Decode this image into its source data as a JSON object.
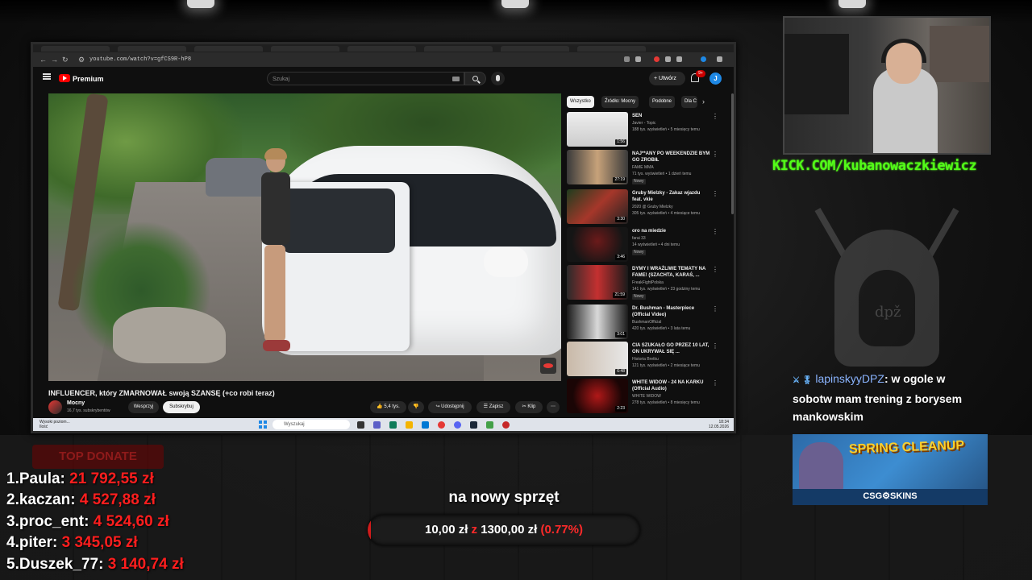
{
  "browser": {
    "url": "youtube.com/watch?v=gfCS9R-hP8",
    "brand": "Premium",
    "search_placeholder": "Szukaj",
    "create_label": "Utwórz",
    "notif_count": "9+",
    "avatar_letter": "J"
  },
  "video": {
    "title": "INFLUENCER, który ZMARNOWAŁ swoją SZANSĘ (+co robi teraz)",
    "channel": "Mocny",
    "subs": "16,7 tys. subskrybentów",
    "support_label": "Wesprzyj",
    "subscribe_label": "Subskrybuj",
    "likes": "5,4 tys.",
    "share_label": "Udostępnij",
    "save_label": "Zapisz",
    "clip_label": "Klip"
  },
  "chips": [
    "Wszystko",
    "Źródło: Mocny",
    "Podobne",
    "Dla C"
  ],
  "recommendations": [
    {
      "title": "SEN",
      "channel": "Javier - Topic",
      "meta": "188 tys. wyświetleń • 5 miesięcy temu",
      "duration": "1:56",
      "new": ""
    },
    {
      "title": "NAJ**ANY PO WEEKENDZIE BYM GO ZROBIŁ",
      "channel": "FAME MMA",
      "meta": "71 tys. wyświetleń • 1 dzień temu",
      "duration": "27:19",
      "new": "Nowy"
    },
    {
      "title": "Gruby Mielzky - Zakaz wjazdu feat. vkie",
      "channel": "2020 @ Gruby Mielzky",
      "meta": "305 tys. wyświetleń • 4 miesiące temu",
      "duration": "3:30",
      "new": ""
    },
    {
      "title": "oro na miedzie",
      "channel": "farai 33",
      "meta": "14 wyświetleń • 4 dni temu",
      "duration": "3:46",
      "new": "Nowy"
    },
    {
      "title": "DYMY I WRAŻLIWE TEMATY NA FAME! (SZACHTA, KARAŚ, ...",
      "channel": "FreakFightPolska",
      "meta": "141 tys. wyświetleń • 23 godziny temu",
      "duration": "21:59",
      "new": "Nowy"
    },
    {
      "title": "Dr. Bushman - Masterpiece (Official Video)",
      "channel": "BushmanOfficial",
      "meta": "420 tys. wyświetleń • 3 lata temu",
      "duration": "3:01",
      "new": ""
    },
    {
      "title": "CIA SZUKAŁO GO PRZEZ 10 LAT, ON UKRYWAŁ SIĘ ...",
      "channel": "Historia Bretku",
      "meta": "121 tys. wyświetleń • 2 miesiące temu",
      "duration": "6:48",
      "new": ""
    },
    {
      "title": "WHITE WIDOW - 24 NA KARKU (Official Audio)",
      "channel": "WHITE WIDOW",
      "meta": "278 tys. wyświetleń • 8 miesięcy temu",
      "duration": "2:23",
      "new": ""
    }
  ],
  "taskbar": {
    "weather": "Wysoki poziom...",
    "weather_sub": "Ilość",
    "search": "Wyszukaj",
    "time": "18:34",
    "date": "12.05.2026"
  },
  "overlay": {
    "kick_url": "KICK.COM/kubanowaczkiewicz",
    "chat_user": "lapinskyyDPZ",
    "chat_message": ": w ogole w sobotw mam trening z borysem mankowskim",
    "chat_badges": "⚔ 🎖",
    "emblem_text": "dpž",
    "ad_title": "SPRING CLEANUP",
    "ad_brand": "CSG⚙SKINS",
    "top_donate_label": "TOP DONATE",
    "donors": [
      {
        "rank": "1.",
        "name": "Paula:",
        "amount": "21 792,55 zł"
      },
      {
        "rank": "2.",
        "name": "kaczan:",
        "amount": "4 527,88 zł"
      },
      {
        "rank": "3.",
        "name": "proc_ent:",
        "amount": "4 524,60 zł"
      },
      {
        "rank": "4.",
        "name": "piter:",
        "amount": "3 345,05 zł"
      },
      {
        "rank": "5.",
        "name": "Duszek_77:",
        "amount": "3 140,74 zł"
      }
    ],
    "goal_title": "na nowy sprzęt",
    "goal_current": "10,00 zł",
    "goal_sep": "z",
    "goal_target": "1300,00 zł",
    "goal_percent": "(0.77%)",
    "goal_fraction": 0.0077
  }
}
